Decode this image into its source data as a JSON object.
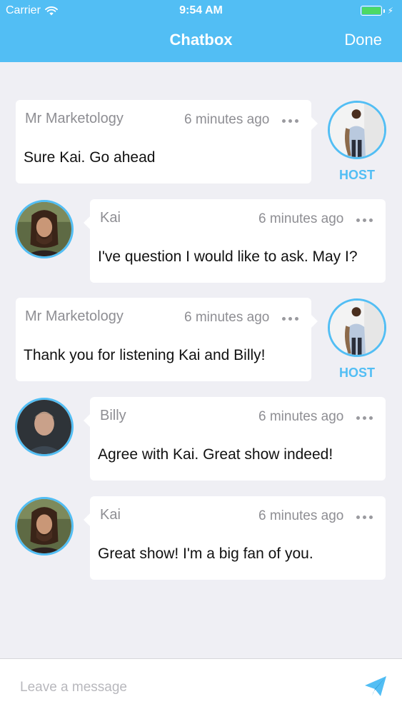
{
  "status_bar": {
    "carrier": "Carrier",
    "time": "9:54 AM"
  },
  "nav": {
    "title": "Chatbox",
    "done_label": "Done"
  },
  "messages": [
    {
      "sender": "Mr Marketology",
      "time": "6 minutes ago",
      "text": "Sure Kai. Go ahead",
      "role": "host",
      "badge": "HOST"
    },
    {
      "sender": "Kai",
      "time": "6 minutes ago",
      "text": "I've question I would like to ask. May I?",
      "role": "guest"
    },
    {
      "sender": "Mr Marketology",
      "time": "6 minutes ago",
      "text": "Thank you for listening Kai and Billy!",
      "role": "host",
      "badge": "HOST"
    },
    {
      "sender": "Billy",
      "time": "6 minutes ago",
      "text": "Agree with Kai. Great show indeed!",
      "role": "guest"
    },
    {
      "sender": "Kai",
      "time": "6 minutes ago",
      "text": "Great show! I'm a big fan of you.",
      "role": "guest"
    }
  ],
  "composer": {
    "placeholder": "Leave a message",
    "value": ""
  },
  "icons": {
    "wifi": "wifi-icon",
    "battery": "battery-icon",
    "more": "ellipsis-icon",
    "send": "paper-plane-icon"
  },
  "colors": {
    "accent": "#52bef4",
    "background": "#efeff4",
    "battery": "#4cd964"
  }
}
